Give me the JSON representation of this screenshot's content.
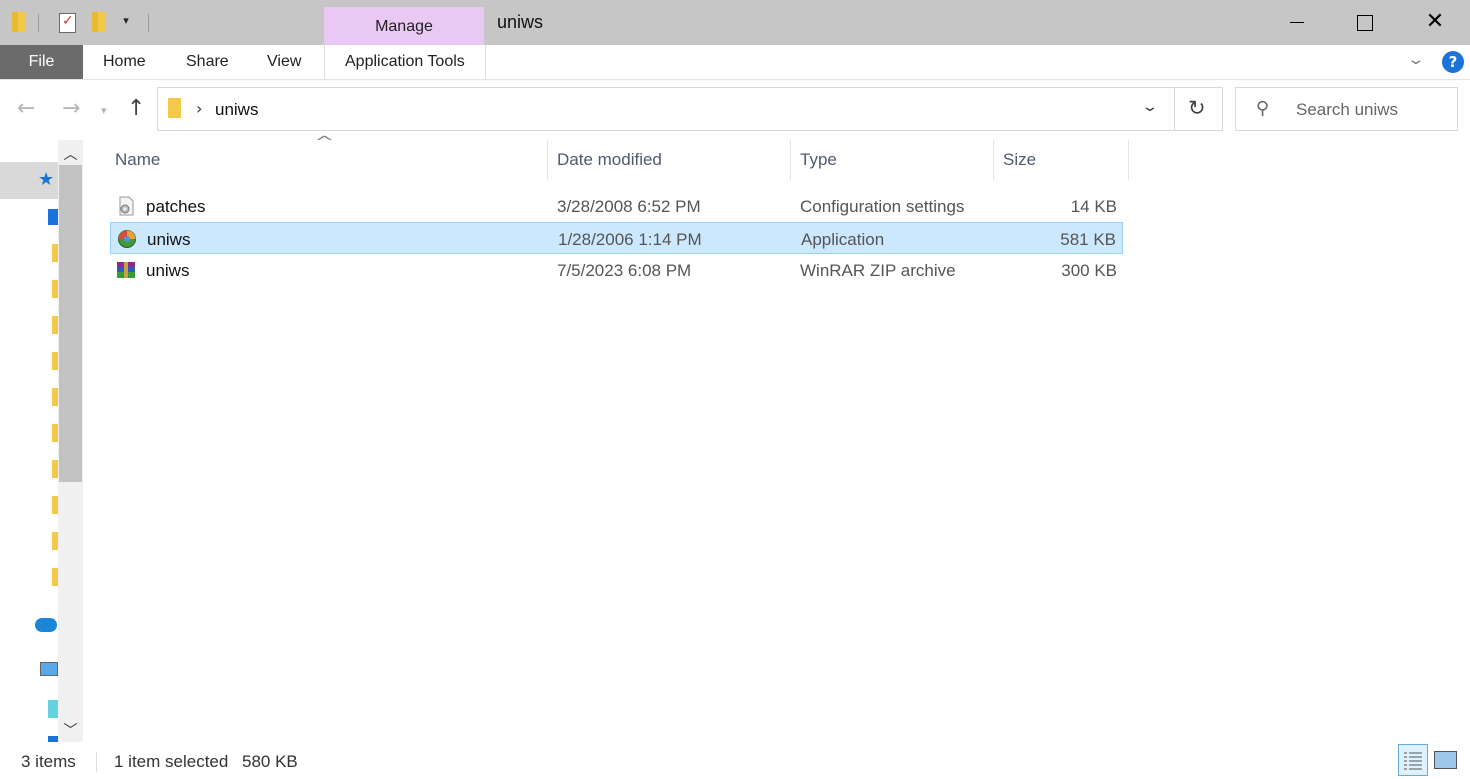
{
  "titlebar": {
    "manage_tab": "Manage",
    "title": "uniws",
    "dropdown_glyph": "▾",
    "close_glyph": "✕"
  },
  "ribbon": {
    "file": "File",
    "home": "Home",
    "share": "Share",
    "view": "View",
    "application_tools": "Application Tools",
    "help": "?"
  },
  "address": {
    "path": "uniws",
    "search_placeholder": "Search uniws"
  },
  "columns": {
    "name": "Name",
    "date": "Date modified",
    "type": "Type",
    "size": "Size"
  },
  "files": [
    {
      "name": "patches",
      "date": "3/28/2008 6:52 PM",
      "type": "Configuration settings",
      "size": "14 KB",
      "icon": "config-file-icon",
      "selected": false
    },
    {
      "name": "uniws",
      "date": "1/28/2006 1:14 PM",
      "type": "Application",
      "size": "581 KB",
      "icon": "application-icon",
      "selected": true
    },
    {
      "name": "uniws",
      "date": "7/5/2023 6:08 PM",
      "type": "WinRAR ZIP archive",
      "size": "300 KB",
      "icon": "winrar-archive-icon",
      "selected": false
    }
  ],
  "status": {
    "items": "3 items",
    "selected": "1 item selected",
    "selected_size": "580 KB"
  },
  "colors": {
    "selection_bg": "#cce8ff",
    "manage_tab_bg": "#e9c8f3",
    "file_tab_bg": "#6b6b6b"
  }
}
